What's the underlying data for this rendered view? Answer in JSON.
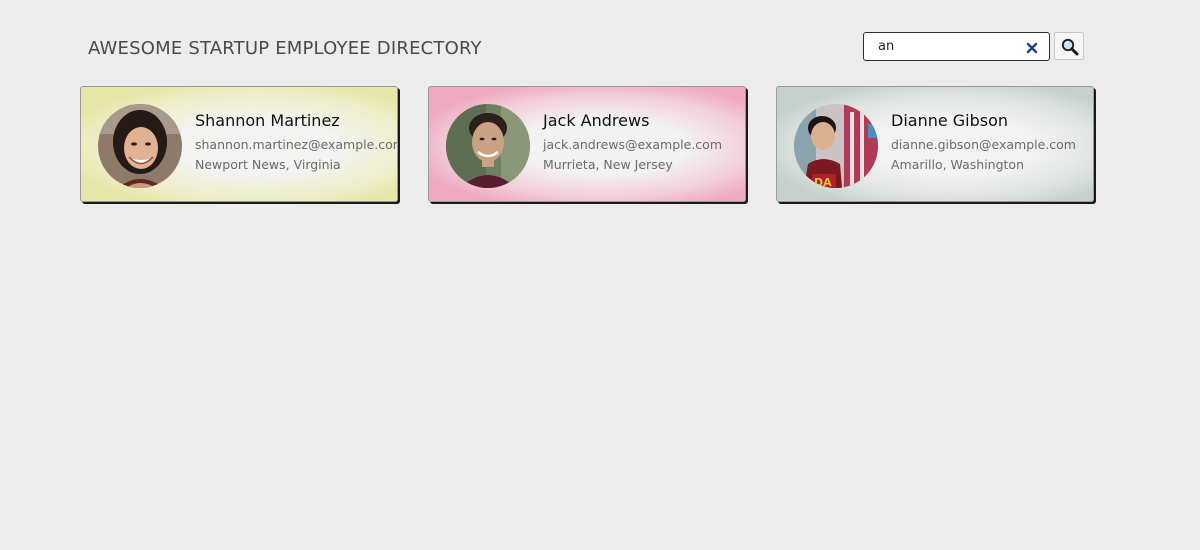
{
  "header": {
    "title": "AWESOME STARTUP EMPLOYEE DIRECTORY"
  },
  "search": {
    "value": "an",
    "clear_icon": "close-icon",
    "submit_icon": "magnifier-icon"
  },
  "employees": [
    {
      "name": "Shannon Martinez",
      "email": "shannon.martinez@example.com",
      "location": "Newport News, Virginia"
    },
    {
      "name": "Jack Andrews",
      "email": "jack.andrews@example.com",
      "location": "Murrieta, New Jersey"
    },
    {
      "name": "Dianne Gibson",
      "email": "dianne.gibson@example.com",
      "location": "Amarillo, Washington"
    }
  ],
  "colors": {
    "background": "#ececec",
    "card_yellow": "#e6e6a8",
    "card_pink": "#efa9c0",
    "card_gray": "#c7d1cc",
    "clear_icon": "#1f3f8a"
  }
}
